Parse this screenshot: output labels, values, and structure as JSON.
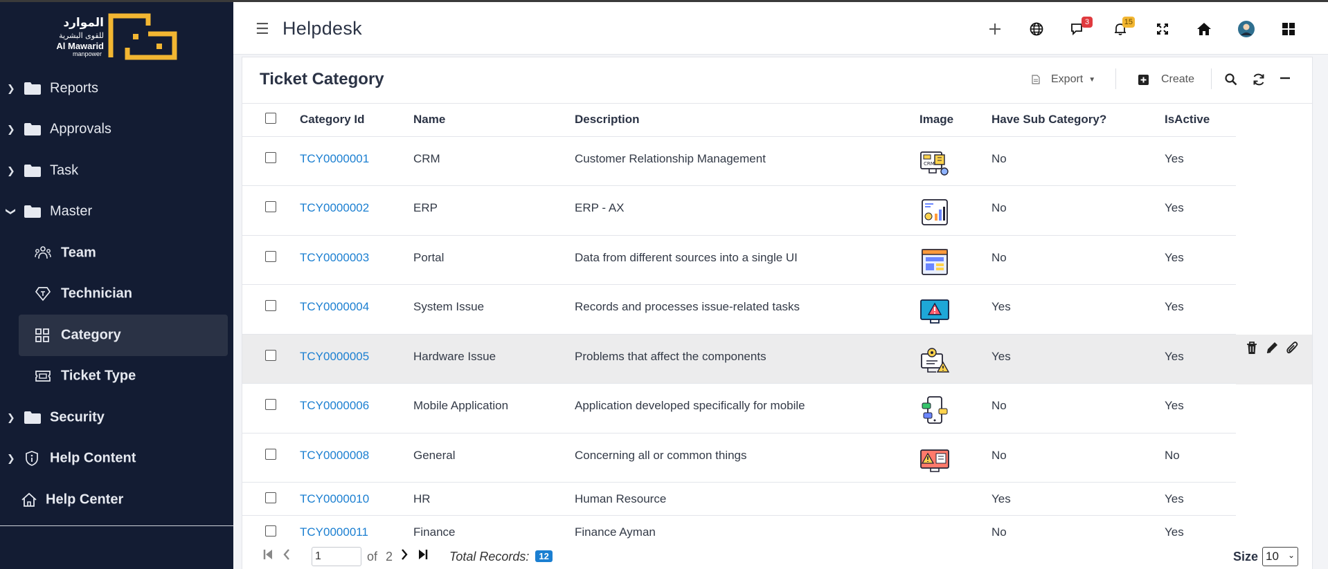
{
  "logo": {
    "arabic_line1": "الموارد",
    "arabic_line2": "للقوى البشرية",
    "english_line1": "Al Mawarid",
    "english_line2": "manpower",
    "brand_color": "#f2b632"
  },
  "sidebar": {
    "items": [
      {
        "label": "Reports",
        "icon": "folder-icon"
      },
      {
        "label": "Approvals",
        "icon": "folder-icon"
      },
      {
        "label": "Task",
        "icon": "folder-icon"
      },
      {
        "label": "Master",
        "icon": "folder-icon",
        "expanded": true
      },
      {
        "label": "Team",
        "icon": "users-icon"
      },
      {
        "label": "Technician",
        "icon": "tag-icon"
      },
      {
        "label": "Category",
        "icon": "grid-icon",
        "active": true
      },
      {
        "label": "Ticket Type",
        "icon": "ticket-icon"
      },
      {
        "label": "Security",
        "icon": "folder-icon"
      },
      {
        "label": "Help Content",
        "icon": "info-icon"
      },
      {
        "label": "Help Center",
        "icon": "home-icon"
      }
    ]
  },
  "header": {
    "title": "Helpdesk",
    "chat_badge": "3",
    "bell_badge": "15",
    "icons": [
      "plus-icon",
      "globe-icon",
      "chat-icon",
      "bell-icon",
      "expand-icon",
      "home-icon",
      "avatar",
      "apps-grid-icon"
    ]
  },
  "card": {
    "title": "Ticket Category",
    "export_label": "Export",
    "create_label": "Create"
  },
  "table": {
    "columns": [
      "Category Id",
      "Name",
      "Description",
      "Image",
      "Have Sub Category?",
      "IsActive"
    ],
    "rows": [
      {
        "id": "TCY0000001",
        "name": "CRM",
        "description": "Customer Relationship Management",
        "image": "crm-icon",
        "sub": "No",
        "active": "Yes"
      },
      {
        "id": "TCY0000002",
        "name": "ERP",
        "description": "ERP - AX",
        "image": "erp-icon",
        "sub": "No",
        "active": "Yes"
      },
      {
        "id": "TCY0000003",
        "name": "Portal",
        "description": "Data from different sources into a single UI",
        "image": "portal-icon",
        "sub": "No",
        "active": "Yes"
      },
      {
        "id": "TCY0000004",
        "name": "System Issue",
        "description": "Records and processes issue-related tasks",
        "image": "system-issue-icon",
        "sub": "Yes",
        "active": "Yes"
      },
      {
        "id": "TCY0000005",
        "name": "Hardware Issue",
        "description": "Problems that affect the components",
        "image": "hardware-issue-icon",
        "sub": "Yes",
        "active": "Yes"
      },
      {
        "id": "TCY0000006",
        "name": "Mobile Application",
        "description": "Application developed specifically for mobile",
        "image": "mobile-app-icon",
        "sub": "No",
        "active": "Yes"
      },
      {
        "id": "TCY0000008",
        "name": "General",
        "description": "Concerning all or common things",
        "image": "general-icon",
        "sub": "No",
        "active": "No"
      },
      {
        "id": "TCY0000010",
        "name": "HR",
        "description": "Human Resource",
        "image": "",
        "sub": "Yes",
        "active": "Yes"
      },
      {
        "id": "TCY0000011",
        "name": "Finance",
        "description": "Finance Ayman",
        "image": "",
        "sub": "No",
        "active": "Yes"
      }
    ]
  },
  "pager": {
    "page": "1",
    "of_label": "of",
    "total_pages": "2",
    "total_label": "Total Records:",
    "total_records": "12",
    "size_label": "Size",
    "size_value": "10"
  },
  "colors": {
    "sidebar_bg": "#131c33",
    "link": "#1b7fd1",
    "chat_badge": "#e03a3e",
    "bell_badge": "#f2b632"
  }
}
